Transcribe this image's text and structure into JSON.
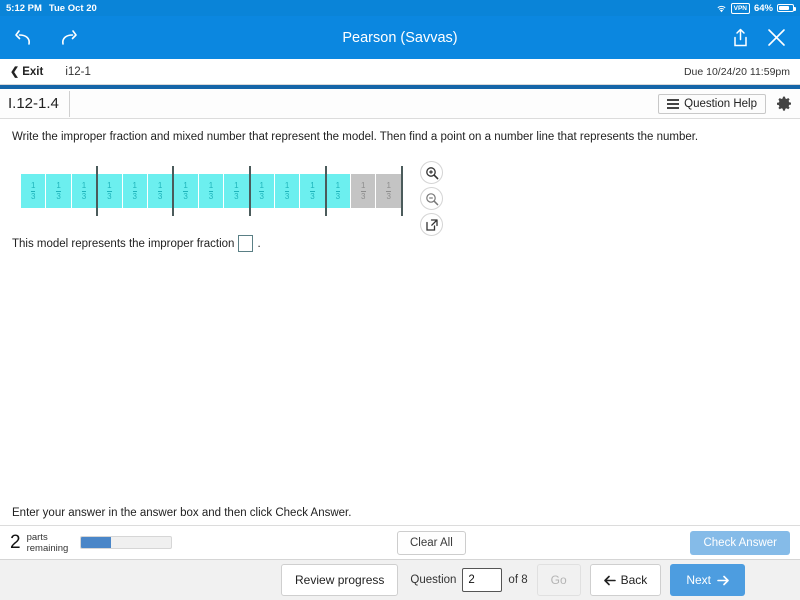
{
  "status_bar": {
    "time": "5:12 PM",
    "date": "Tue Oct 20",
    "vpn_label": "VPN",
    "battery_percent": "64%",
    "battery_level": 64,
    "wifi_icon": "wifi-icon",
    "battery_icon": "battery-icon"
  },
  "nav_bar": {
    "title": "Pearson (Savvas)",
    "back_icon": "undo-arrow-icon",
    "forward_icon": "redo-arrow-icon",
    "share_icon": "share-icon",
    "close_icon": "close-icon",
    "background_color": "#0b87e0"
  },
  "exit_bar": {
    "exit_label": "Exit",
    "exit_chevron": "chevron-left-icon",
    "assignment_id": "i12-1",
    "due_label": "Due 10/24/20 11:59pm"
  },
  "title_bar": {
    "exercise_title": "I.12-1.4",
    "question_help_label": "Question Help",
    "question_help_icon": "list-icon",
    "settings_icon": "gear-icon"
  },
  "question": {
    "prompt": "Write the improper fraction and mixed number that represent the model. Then find a point on a number line that represents the number.",
    "answer_sentence_prefix": "This model represents the improper fraction",
    "answer_sentence_suffix": ".",
    "answer_value": "",
    "tools": [
      {
        "name": "zoom-in-icon",
        "label": "Zoom in"
      },
      {
        "name": "zoom-out-icon",
        "label": "Zoom out"
      },
      {
        "name": "open-in-new-icon",
        "label": "Open in new window"
      }
    ]
  },
  "model": {
    "numerator": "1",
    "denominator": "3",
    "total_tiles": 15,
    "filled_tiles": 13,
    "empty_tiles": 2,
    "tiles_per_whole": 3,
    "whole_units": 5,
    "filled_color": "#6CEFEF",
    "empty_color": "#C4C4C4",
    "divider_color": "#4b5b5b"
  },
  "footer": {
    "hint": "Enter your answer in the answer box and then click Check Answer.",
    "parts_remaining_count": "2",
    "parts_remaining_label_line1": "parts",
    "parts_remaining_label_line2": "remaining",
    "progress_percent": 33,
    "clear_all_label": "Clear All",
    "check_answer_label": "Check Answer"
  },
  "nav_footer": {
    "review_progress_label": "Review progress",
    "question_label": "Question",
    "question_number": "2",
    "of_label": "of 8",
    "go_label": "Go",
    "back_label": "Back",
    "back_icon": "arrow-left-icon",
    "next_label": "Next",
    "next_icon": "arrow-right-icon",
    "next_color": "#4d9de0"
  }
}
